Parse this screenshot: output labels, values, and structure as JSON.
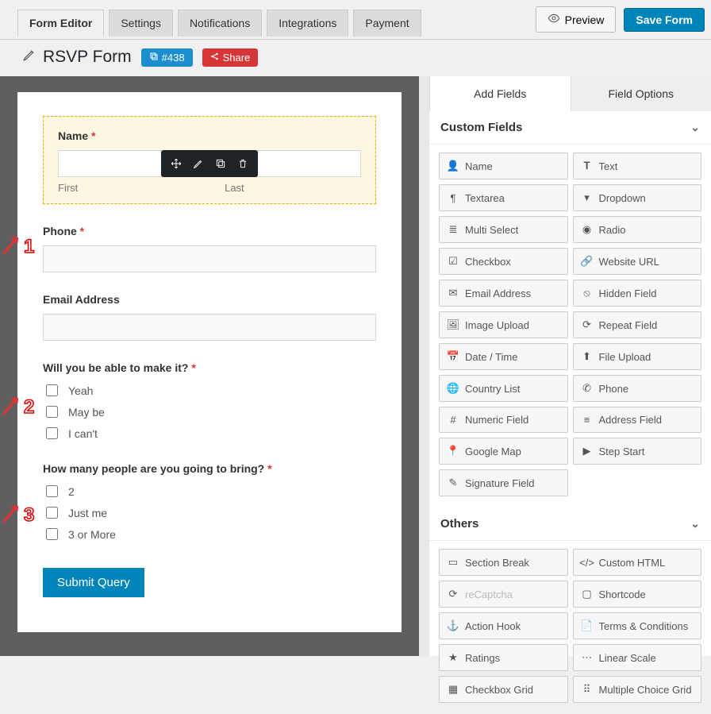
{
  "top": {
    "tabs": [
      "Form Editor",
      "Settings",
      "Notifications",
      "Integrations",
      "Payment"
    ],
    "active_tab": 0,
    "preview": "Preview",
    "save": "Save Form"
  },
  "title": {
    "name": "RSVP Form",
    "id_badge": "#438",
    "share": "Share"
  },
  "form_fields": {
    "name": {
      "label": "Name",
      "sub_first": "First",
      "sub_last": "Last"
    },
    "phone": {
      "label": "Phone"
    },
    "email": {
      "label": "Email Address"
    },
    "attend": {
      "label": "Will you be able to make it?",
      "options": [
        "Yeah",
        "May be",
        "I can't"
      ]
    },
    "people": {
      "label": "How many people are you going to bring?",
      "options": [
        "2",
        "Just me",
        "3 or More"
      ]
    },
    "submit": "Submit Query"
  },
  "sidebar": {
    "tab_add": "Add Fields",
    "tab_opts": "Field Options",
    "sect_custom": "Custom Fields",
    "sect_others": "Others",
    "custom": [
      "Name",
      "Text",
      "Textarea",
      "Dropdown",
      "Multi Select",
      "Radio",
      "Checkbox",
      "Website URL",
      "Email Address",
      "Hidden Field",
      "Image Upload",
      "Repeat Field",
      "Date / Time",
      "File Upload",
      "Country List",
      "Phone",
      "Numeric Field",
      "Address Field",
      "Google Map",
      "Step Start",
      "Signature Field"
    ],
    "others": [
      "Section Break",
      "Custom HTML",
      "reCaptcha",
      "Shortcode",
      "Action Hook",
      "Terms & Conditions",
      "Ratings",
      "Linear Scale",
      "Checkbox Grid",
      "Multiple Choice Grid"
    ]
  },
  "annotations": [
    "1",
    "2",
    "3"
  ]
}
